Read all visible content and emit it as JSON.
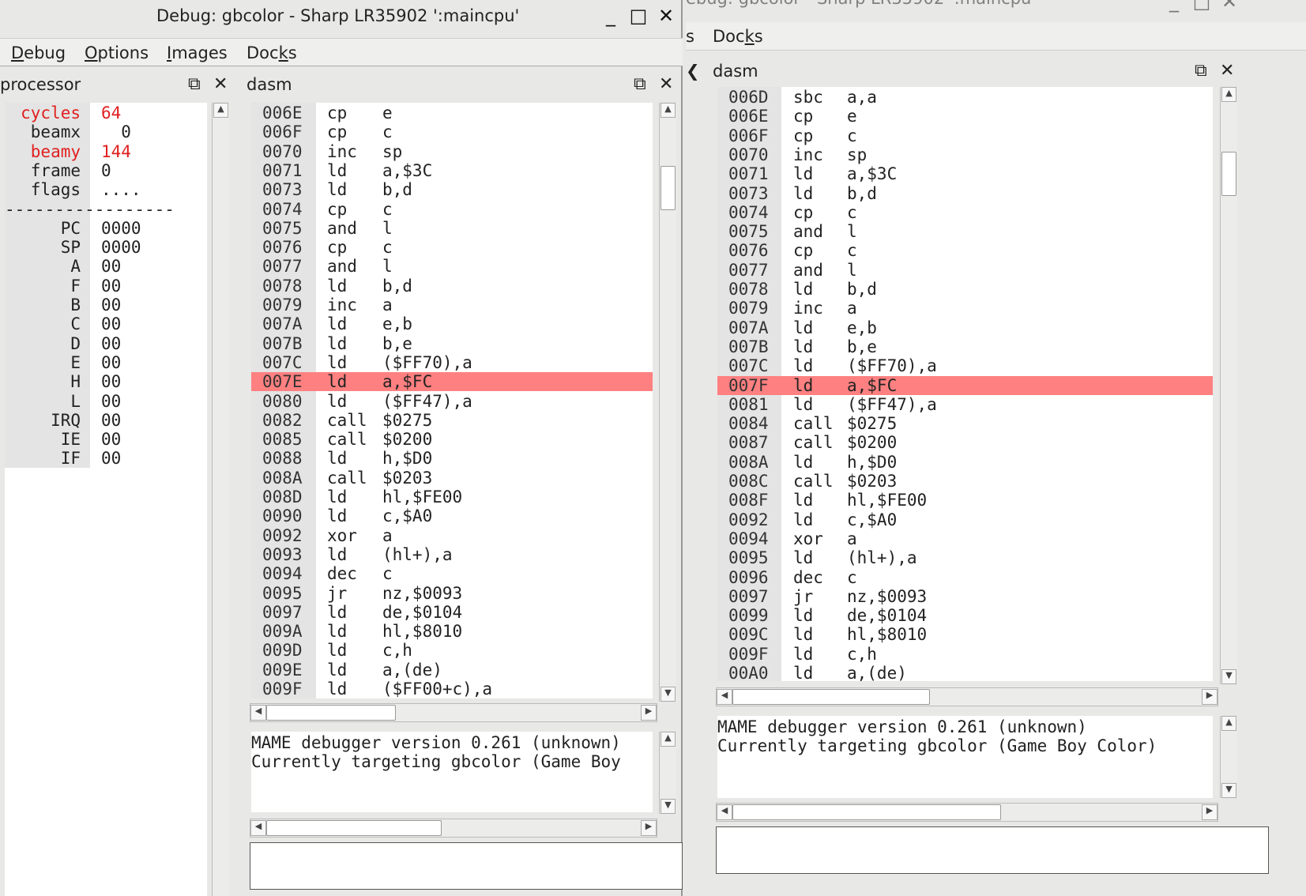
{
  "front": {
    "title": "Debug: gbcolor - Sharp LR35902 ':maincpu'",
    "menu": [
      "Debug",
      "Options",
      "Images",
      "Docks"
    ],
    "processor_title": "processor",
    "dasm_title": "dasm",
    "processor": {
      "top": [
        {
          "name": "cycles",
          "value": "64",
          "red": true
        },
        {
          "name": "beamx",
          "value": "  0",
          "red": false
        },
        {
          "name": "beamy",
          "value": "144",
          "red": true
        },
        {
          "name": "frame",
          "value": "0",
          "red": false
        },
        {
          "name": "flags",
          "value": "....",
          "red": false
        }
      ],
      "separator": "-----------------",
      "regs": [
        {
          "name": "PC",
          "value": "0000"
        },
        {
          "name": "SP",
          "value": "0000"
        },
        {
          "name": "A",
          "value": "00"
        },
        {
          "name": "F",
          "value": "00"
        },
        {
          "name": "B",
          "value": "00"
        },
        {
          "name": "C",
          "value": "00"
        },
        {
          "name": "D",
          "value": "00"
        },
        {
          "name": "E",
          "value": "00"
        },
        {
          "name": "H",
          "value": "00"
        },
        {
          "name": "L",
          "value": "00"
        },
        {
          "name": "IRQ",
          "value": "00"
        },
        {
          "name": "IE",
          "value": "00"
        },
        {
          "name": "IF",
          "value": "00"
        }
      ]
    },
    "dasm": [
      {
        "addr": "006E",
        "op": "cp",
        "arg": "e"
      },
      {
        "addr": "006F",
        "op": "cp",
        "arg": "c"
      },
      {
        "addr": "0070",
        "op": "inc",
        "arg": "sp"
      },
      {
        "addr": "0071",
        "op": "ld",
        "arg": "a,$3C"
      },
      {
        "addr": "0073",
        "op": "ld",
        "arg": "b,d"
      },
      {
        "addr": "0074",
        "op": "cp",
        "arg": "c"
      },
      {
        "addr": "0075",
        "op": "and",
        "arg": "l"
      },
      {
        "addr": "0076",
        "op": "cp",
        "arg": "c"
      },
      {
        "addr": "0077",
        "op": "and",
        "arg": "l"
      },
      {
        "addr": "0078",
        "op": "ld",
        "arg": "b,d"
      },
      {
        "addr": "0079",
        "op": "inc",
        "arg": "a"
      },
      {
        "addr": "007A",
        "op": "ld",
        "arg": "e,b"
      },
      {
        "addr": "007B",
        "op": "ld",
        "arg": "b,e"
      },
      {
        "addr": "007C",
        "op": "ld",
        "arg": "($FF70),a"
      },
      {
        "addr": "007E",
        "op": "ld",
        "arg": "a,$FC",
        "hl": true
      },
      {
        "addr": "0080",
        "op": "ld",
        "arg": "($FF47),a"
      },
      {
        "addr": "0082",
        "op": "call",
        "arg": "$0275"
      },
      {
        "addr": "0085",
        "op": "call",
        "arg": "$0200"
      },
      {
        "addr": "0088",
        "op": "ld",
        "arg": "h,$D0"
      },
      {
        "addr": "008A",
        "op": "call",
        "arg": "$0203"
      },
      {
        "addr": "008D",
        "op": "ld",
        "arg": "hl,$FE00"
      },
      {
        "addr": "0090",
        "op": "ld",
        "arg": "c,$A0"
      },
      {
        "addr": "0092",
        "op": "xor",
        "arg": "a"
      },
      {
        "addr": "0093",
        "op": "ld",
        "arg": "(hl+),a"
      },
      {
        "addr": "0094",
        "op": "dec",
        "arg": "c"
      },
      {
        "addr": "0095",
        "op": "jr",
        "arg": "nz,$0093"
      },
      {
        "addr": "0097",
        "op": "ld",
        "arg": "de,$0104"
      },
      {
        "addr": "009A",
        "op": "ld",
        "arg": "hl,$8010"
      },
      {
        "addr": "009D",
        "op": "ld",
        "arg": "c,h"
      },
      {
        "addr": "009E",
        "op": "ld",
        "arg": "a,(de)"
      },
      {
        "addr": "009F",
        "op": "ld",
        "arg": "($FF00+c),a"
      }
    ],
    "console": [
      "MAME debugger version 0.261 (unknown)",
      "Currently targeting gbcolor (Game Boy"
    ]
  },
  "back": {
    "title_fragment": "ebug: gbcolor - Sharp LR35902 ':maincpu",
    "menu_left_fragment": "s",
    "menu_docks": "Docks",
    "dasm_title": "dasm",
    "dasm": [
      {
        "addr": "006D",
        "op": "sbc",
        "arg": "a,a"
      },
      {
        "addr": "006E",
        "op": "cp",
        "arg": "e"
      },
      {
        "addr": "006F",
        "op": "cp",
        "arg": "c"
      },
      {
        "addr": "0070",
        "op": "inc",
        "arg": "sp"
      },
      {
        "addr": "0071",
        "op": "ld",
        "arg": "a,$3C"
      },
      {
        "addr": "0073",
        "op": "ld",
        "arg": "b,d"
      },
      {
        "addr": "0074",
        "op": "cp",
        "arg": "c"
      },
      {
        "addr": "0075",
        "op": "and",
        "arg": "l"
      },
      {
        "addr": "0076",
        "op": "cp",
        "arg": "c"
      },
      {
        "addr": "0077",
        "op": "and",
        "arg": "l"
      },
      {
        "addr": "0078",
        "op": "ld",
        "arg": "b,d"
      },
      {
        "addr": "0079",
        "op": "inc",
        "arg": "a"
      },
      {
        "addr": "007A",
        "op": "ld",
        "arg": "e,b"
      },
      {
        "addr": "007B",
        "op": "ld",
        "arg": "b,e"
      },
      {
        "addr": "007C",
        "op": "ld",
        "arg": "($FF70),a"
      },
      {
        "addr": "007F",
        "op": "ld",
        "arg": "a,$FC",
        "hl": true
      },
      {
        "addr": "0081",
        "op": "ld",
        "arg": "($FF47),a"
      },
      {
        "addr": "0084",
        "op": "call",
        "arg": "$0275"
      },
      {
        "addr": "0087",
        "op": "call",
        "arg": "$0200"
      },
      {
        "addr": "008A",
        "op": "ld",
        "arg": "h,$D0"
      },
      {
        "addr": "008C",
        "op": "call",
        "arg": "$0203"
      },
      {
        "addr": "008F",
        "op": "ld",
        "arg": "hl,$FE00"
      },
      {
        "addr": "0092",
        "op": "ld",
        "arg": "c,$A0"
      },
      {
        "addr": "0094",
        "op": "xor",
        "arg": "a"
      },
      {
        "addr": "0095",
        "op": "ld",
        "arg": "(hl+),a"
      },
      {
        "addr": "0096",
        "op": "dec",
        "arg": "c"
      },
      {
        "addr": "0097",
        "op": "jr",
        "arg": "nz,$0093"
      },
      {
        "addr": "0099",
        "op": "ld",
        "arg": "de,$0104"
      },
      {
        "addr": "009C",
        "op": "ld",
        "arg": "hl,$8010"
      },
      {
        "addr": "009F",
        "op": "ld",
        "arg": "c,h"
      },
      {
        "addr": "00A0",
        "op": "ld",
        "arg": "a,(de)"
      }
    ],
    "console": [
      "MAME debugger version 0.261 (unknown)",
      "Currently targeting gbcolor (Game Boy Color)"
    ]
  },
  "icons": {
    "minimize": "minimize-icon",
    "maximize": "maximize-icon",
    "close": "close-icon",
    "float": "float-icon",
    "dock_close": "dock-close-icon"
  },
  "colors": {
    "highlight": "#ff8080",
    "register_changed": "#e02020"
  }
}
